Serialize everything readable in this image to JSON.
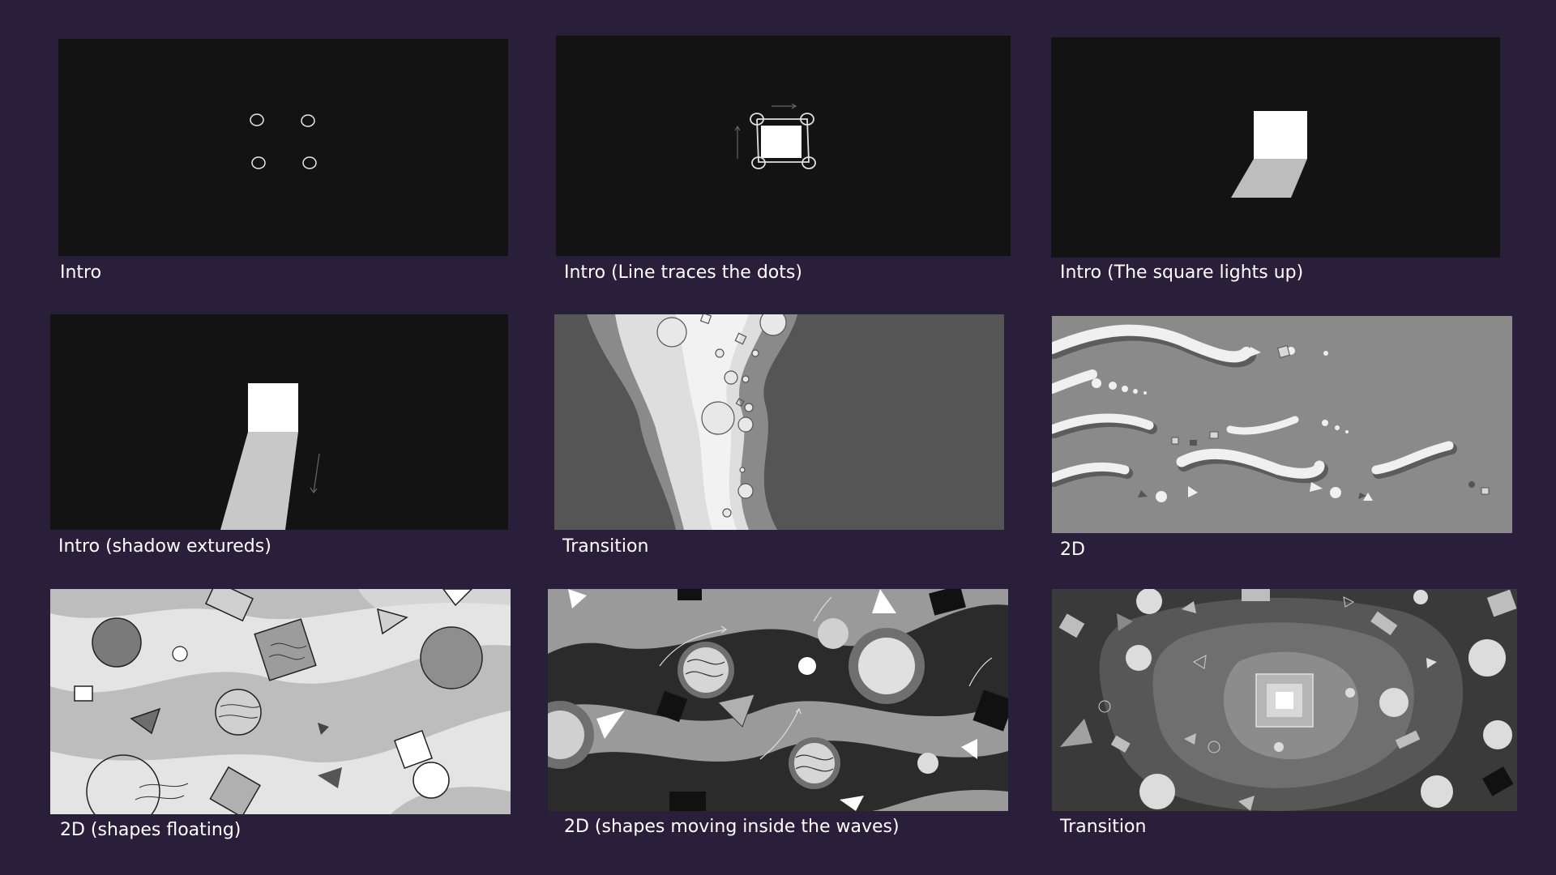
{
  "storyboard": {
    "frames": [
      {
        "caption": "Intro"
      },
      {
        "caption": "Intro (Line traces the dots)"
      },
      {
        "caption": "Intro (The square lights up)"
      },
      {
        "caption": "Intro (shadow extureds)"
      },
      {
        "caption": "Transition"
      },
      {
        "caption": "2D"
      },
      {
        "caption": "2D (shapes floating)"
      },
      {
        "caption": "2D (shapes moving inside the waves)"
      },
      {
        "caption": "Transition"
      }
    ]
  },
  "colors": {
    "background": "#2a1f3b",
    "frame_dark": "#131313",
    "caption_text": "#ffffff"
  }
}
